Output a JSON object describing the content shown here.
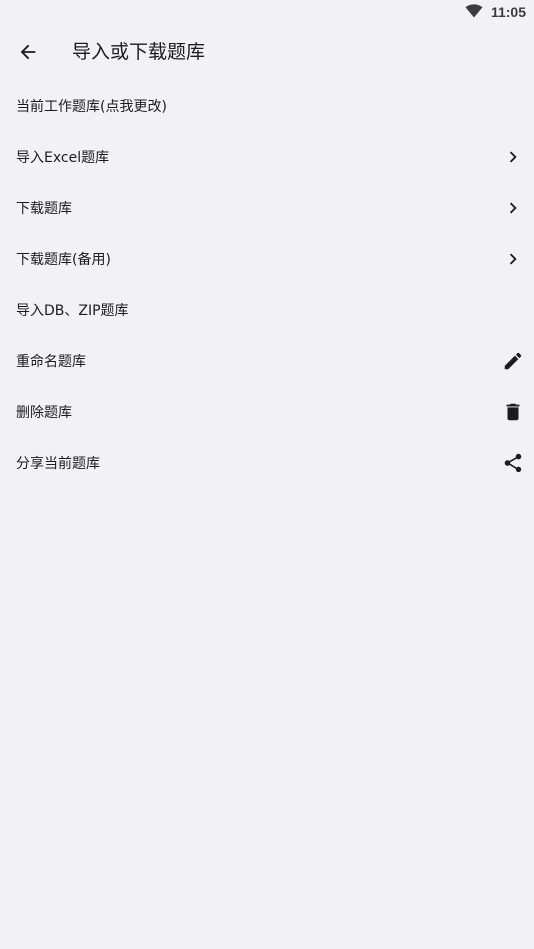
{
  "status_bar": {
    "time": "11:05",
    "wifi_icon": "wifi-icon"
  },
  "app_bar": {
    "back_icon": "arrow-back-icon",
    "title": "导入或下载题库"
  },
  "menu": {
    "items": [
      {
        "label": "当前工作题库(点我更改)",
        "icon": ""
      },
      {
        "label": "导入Excel题库",
        "icon": "chevron-right-icon"
      },
      {
        "label": "下载题库",
        "icon": "chevron-right-icon"
      },
      {
        "label": "下载题库(备用)",
        "icon": "chevron-right-icon"
      },
      {
        "label": "导入DB、ZIP题库",
        "icon": ""
      },
      {
        "label": "重命名题库",
        "icon": "pencil-icon"
      },
      {
        "label": "删除题库",
        "icon": "trash-icon"
      },
      {
        "label": "分享当前题库",
        "icon": "share-icon"
      }
    ]
  },
  "colors": {
    "background": "#f2f1f6",
    "text": "#1c1b1f",
    "icon": "#1c1b1f"
  }
}
